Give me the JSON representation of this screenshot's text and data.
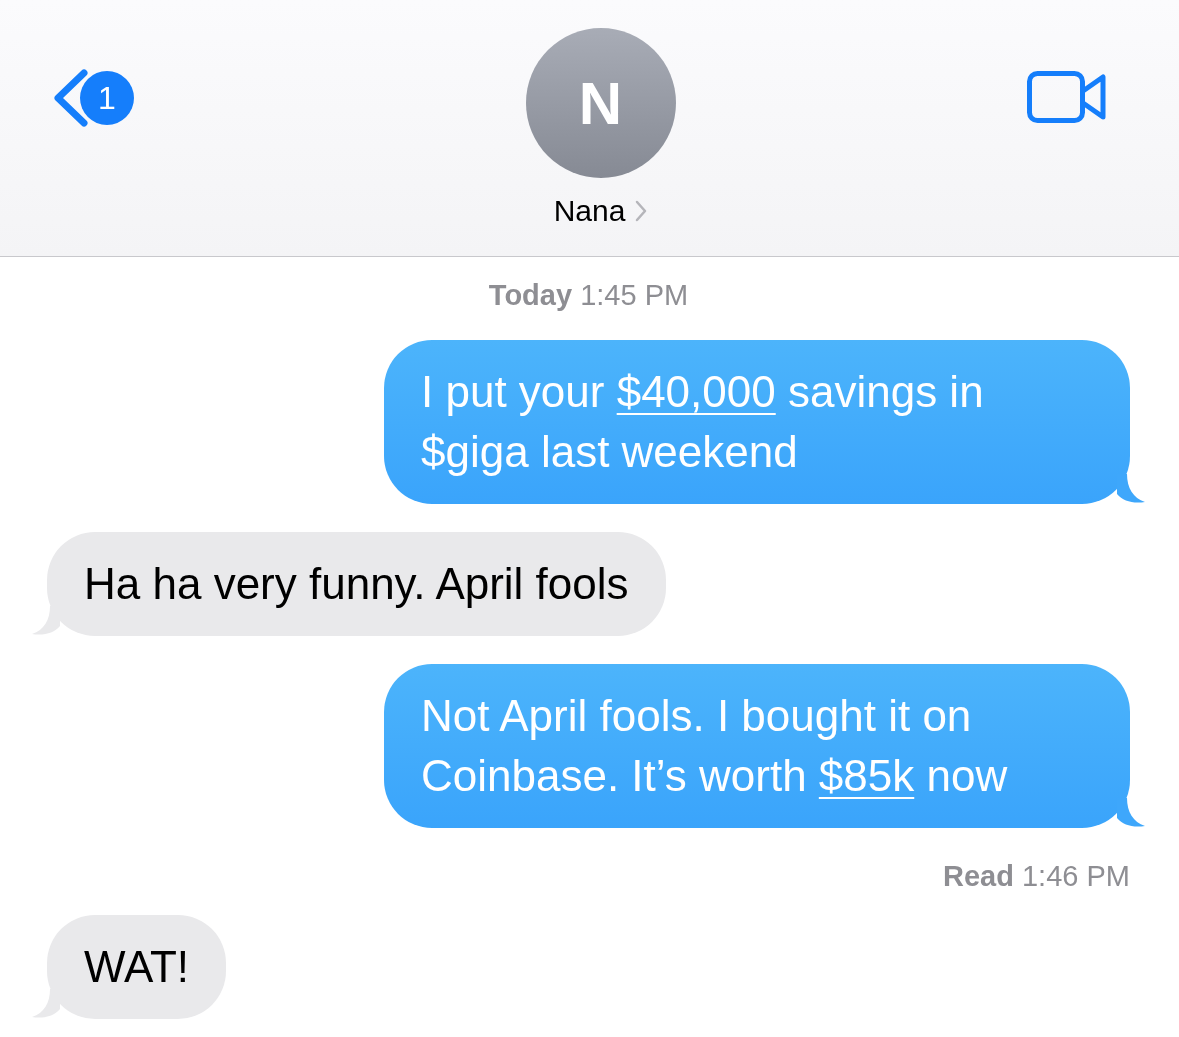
{
  "header": {
    "back_badge": "1",
    "avatar_initial": "N",
    "contact_name": "Nana"
  },
  "conversation": [
    {
      "kind": "timestamp",
      "label": "Today",
      "time": "1:45 PM"
    },
    {
      "kind": "outgoing",
      "parts": [
        {
          "kind": "text",
          "text": "I put your "
        },
        {
          "kind": "link",
          "text": "$40,000"
        },
        {
          "kind": "text",
          "text": " savings in $giga last weekend"
        }
      ]
    },
    {
      "kind": "incoming",
      "parts": [
        {
          "kind": "text",
          "text": "Ha ha very funny. April fools"
        }
      ]
    },
    {
      "kind": "outgoing",
      "parts": [
        {
          "kind": "text",
          "text": "Not April fools. I bought it on Coinbase. It’s worth "
        },
        {
          "kind": "link",
          "text": "$85k"
        },
        {
          "kind": "text",
          "text": " now"
        }
      ]
    },
    {
      "kind": "receipt",
      "label": "Read",
      "time": "1:46 PM"
    },
    {
      "kind": "incoming",
      "parts": [
        {
          "kind": "text",
          "text": "WAT!"
        }
      ]
    }
  ]
}
